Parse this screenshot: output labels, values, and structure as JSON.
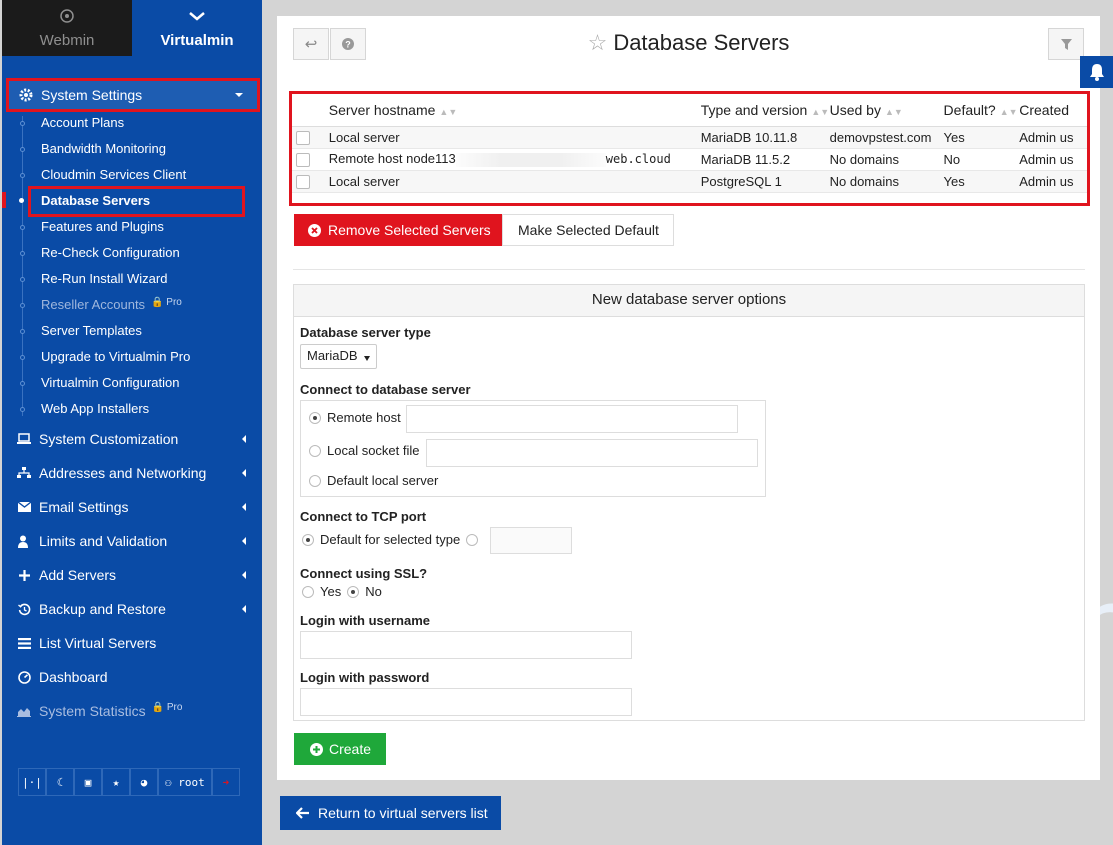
{
  "switcher": {
    "webmin": "Webmin",
    "virtualmin": "Virtualmin"
  },
  "sidebar": {
    "header": "System Settings",
    "items": [
      {
        "label": "Account Plans"
      },
      {
        "label": "Bandwidth Monitoring"
      },
      {
        "label": "Cloudmin Services Client"
      },
      {
        "label": "Database Servers"
      },
      {
        "label": "Features and Plugins"
      },
      {
        "label": "Re-Check Configuration"
      },
      {
        "label": "Re-Run Install Wizard"
      },
      {
        "label": "Reseller Accounts",
        "badge": "Pro"
      },
      {
        "label": "Server Templates"
      },
      {
        "label": "Upgrade to Virtualmin Pro"
      },
      {
        "label": "Virtualmin Configuration"
      },
      {
        "label": "Web App Installers"
      }
    ],
    "sections": [
      {
        "label": "System Customization"
      },
      {
        "label": "Addresses and Networking"
      },
      {
        "label": "Email Settings"
      },
      {
        "label": "Limits and Validation"
      },
      {
        "label": "Add Servers"
      },
      {
        "label": "Backup and Restore"
      },
      {
        "label": "List Virtual Servers"
      },
      {
        "label": "Dashboard"
      },
      {
        "label": "System Statistics",
        "badge": "Pro"
      }
    ],
    "user": "root"
  },
  "page": {
    "title": "Database Servers"
  },
  "table": {
    "headers": [
      "Server hostname",
      "Type and version",
      "Used by",
      "Default?",
      "Created"
    ],
    "rows": [
      {
        "host": "Local server",
        "host_end": "",
        "type": "MariaDB 10.11.8",
        "used": "demovpstest.com",
        "default": "Yes",
        "created": "Admin us"
      },
      {
        "host": "Remote host node113",
        "host_end": "web.cloud",
        "type": "MariaDB 11.5.2",
        "used": "No domains",
        "default": "No",
        "created": "Admin us"
      },
      {
        "host": "Local server",
        "host_end": "",
        "type": "PostgreSQL 1",
        "used": "No domains",
        "default": "Yes",
        "created": "Admin us"
      }
    ]
  },
  "actions": {
    "remove": "Remove Selected Servers",
    "make_default": "Make Selected Default"
  },
  "options": {
    "title": "New database server options",
    "server_type_label": "Database server type",
    "server_type_value": "MariaDB",
    "connect_label": "Connect to database server",
    "remote_host": "Remote host",
    "local_socket": "Local socket file",
    "default_local": "Default local server",
    "tcp_label": "Connect to TCP port",
    "tcp_default": "Default for selected type",
    "ssl_label": "Connect using SSL?",
    "ssl_yes": "Yes",
    "ssl_no": "No",
    "username_label": "Login with username",
    "password_label": "Login with password"
  },
  "create_label": "Create",
  "return_label": "Return to virtual servers list"
}
